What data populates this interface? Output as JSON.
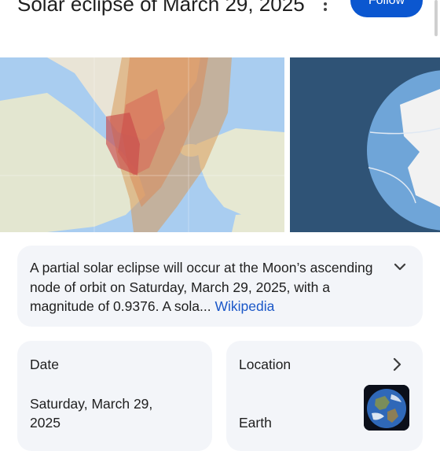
{
  "header": {
    "title": "Solar eclipse of March 29, 2025",
    "follow_label": "Follow",
    "more_icon": "more-vert-icon"
  },
  "images": {
    "map_alt": "eclipse-path-map",
    "globe_alt": "eclipse-globe"
  },
  "summary": {
    "text": "A partial solar eclipse will occur at the Moon’s ascending node of orbit on Saturday, March 29, 2025, with a magnitude of 0.9376. A sola... ",
    "source_link": "Wikipedia",
    "expand_icon": "chevron-down-icon"
  },
  "facts": {
    "date": {
      "label": "Date",
      "value": "Saturday, March 29, 2025"
    },
    "location": {
      "label": "Location",
      "value": "Earth",
      "arrow_icon": "chevron-right-icon",
      "thumb_icon": "earth-thumbnail"
    }
  },
  "colors": {
    "accent": "#0b57d0",
    "link": "#1a57c8",
    "card_bg": "#f3f5f9"
  }
}
